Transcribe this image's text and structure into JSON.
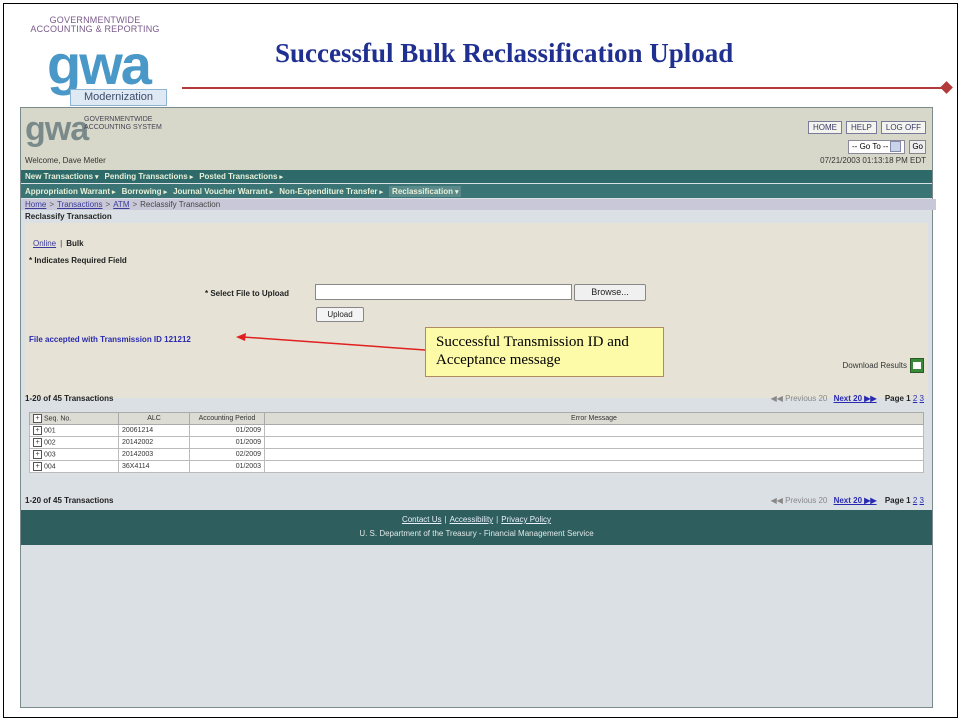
{
  "slide": {
    "logo_line1": "GOVERNMENTWIDE",
    "logo_line2": "ACCOUNTING & REPORTING",
    "logo_letters": "gwa",
    "logo_sub": "Modernization",
    "title": "Successful Bulk Reclassification Upload",
    "callout": "Successful Transmission ID and Acceptance message",
    "accent_color": "#b23a3a",
    "title_color": "#1f3090"
  },
  "app": {
    "logo": "gwa",
    "system_name": "GOVERNMENTWIDE ACCOUNTING SYSTEM",
    "buttons": {
      "home": "HOME",
      "help": "HELP",
      "logoff": "LOG OFF"
    },
    "goto": {
      "label": "-- Go To --",
      "go": "Go"
    },
    "welcome": "Welcome, Dave Metler",
    "datetime": "07/21/2003 01:13:18 PM EDT",
    "nav1": [
      {
        "label": "New Transactions",
        "icon": "chevron-down-icon"
      },
      {
        "label": "Pending Transactions",
        "icon": "chevron-right-icon"
      },
      {
        "label": "Posted Transactions",
        "icon": "chevron-right-icon"
      }
    ],
    "nav2": [
      {
        "label": "Appropriation Warrant",
        "icon": "chevron-right-icon"
      },
      {
        "label": "Borrowing",
        "icon": "chevron-right-icon"
      },
      {
        "label": "Journal Voucher Warrant",
        "icon": "chevron-right-icon"
      },
      {
        "label": "Non-Expenditure Transfer",
        "icon": "chevron-right-icon"
      },
      {
        "label": "Reclassification",
        "icon": "chevron-down-icon"
      }
    ],
    "breadcrumb": {
      "home": "Home",
      "transactions": "Transactions",
      "atm": "ATM",
      "current": "Reclassify Transaction",
      "sep": ">"
    },
    "section_title": "Reclassify Transaction",
    "tabs": {
      "online": "Online",
      "bulk": "Bulk"
    },
    "required_note": "* Indicates Required Field",
    "file_label": "* Select File to Upload",
    "file_value": "",
    "browse_label": "Browse...",
    "upload_label": "Upload",
    "accepted_message": "File accepted with Transmission ID 121212",
    "download_label": "Download Results",
    "pager": {
      "count": "1-20 of 45 Transactions",
      "previous": "◀◀ Previous 20",
      "next": "Next 20 ▶▶",
      "page_label": "Page",
      "pages": [
        "1",
        "2",
        "3"
      ]
    },
    "table": {
      "headers": [
        "Seq. No.",
        "ALC",
        "Accounting Period",
        "Error Message"
      ],
      "rows": [
        {
          "seq": "001",
          "alc": "20061214",
          "period": "01/2009",
          "error": ""
        },
        {
          "seq": "002",
          "alc": "20142002",
          "period": "01/2009",
          "error": ""
        },
        {
          "seq": "003",
          "alc": "20142003",
          "period": "02/2009",
          "error": ""
        },
        {
          "seq": "004",
          "alc": "36X4114",
          "period": "01/2003",
          "error": ""
        }
      ]
    },
    "footer": {
      "contact": "Contact Us",
      "accessibility": "Accessibility",
      "privacy": "Privacy Policy",
      "sep": "|",
      "dept": "U. S. Department of the Treasury - Financial Management Service"
    }
  }
}
